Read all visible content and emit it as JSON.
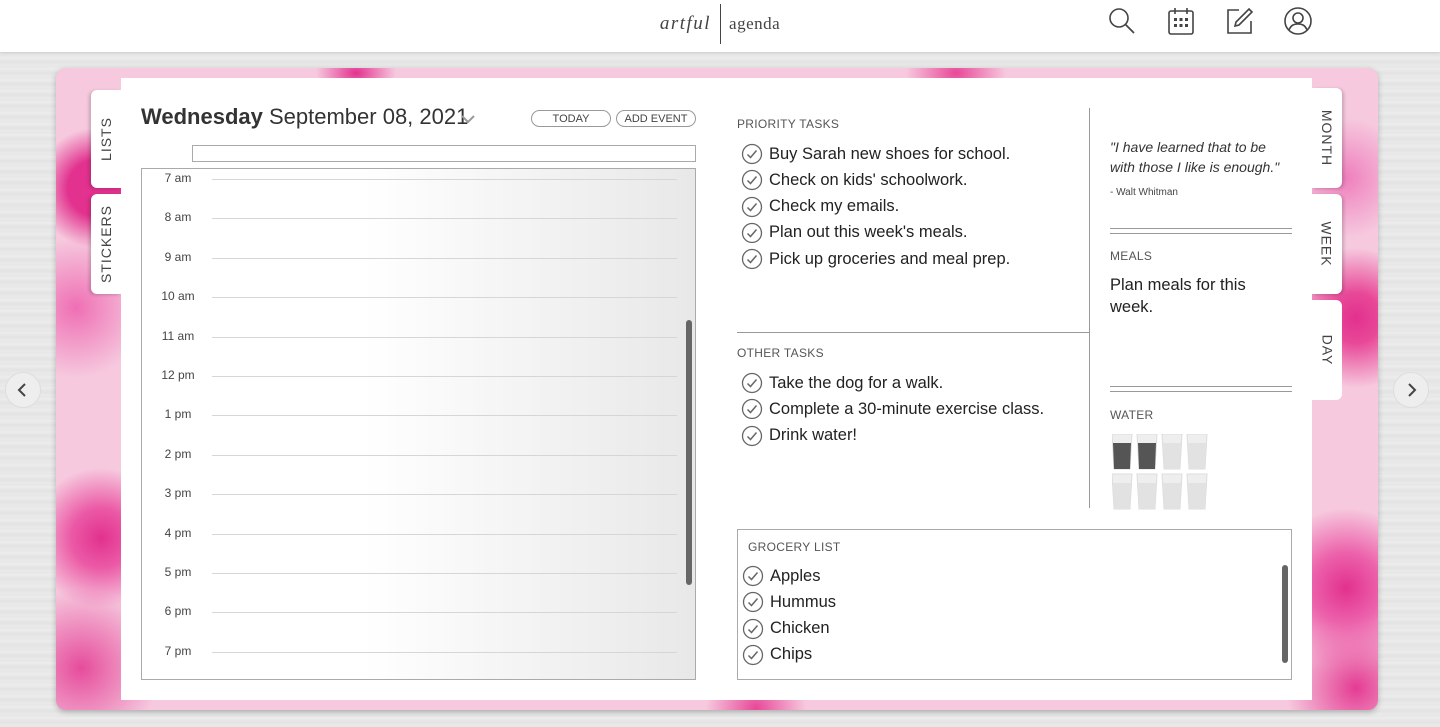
{
  "app": {
    "logo_part1": "artful",
    "logo_part2": "agenda"
  },
  "header_icons": [
    "search-icon",
    "calendar-icon",
    "edit-icon",
    "user-icon"
  ],
  "left_tabs": [
    "LISTS",
    "STICKERS"
  ],
  "right_tabs": [
    "MONTH",
    "WEEK",
    "DAY"
  ],
  "day": {
    "weekday": "Wednesday",
    "date": "September 08, 2021",
    "today_label": "TODAY",
    "add_event_label": "ADD EVENT",
    "hours": [
      "7 am",
      "8 am",
      "9 am",
      "10 am",
      "11 am",
      "12 pm",
      "1 pm",
      "2 pm",
      "3 pm",
      "4 pm",
      "5 pm",
      "6 pm",
      "7 pm"
    ]
  },
  "priority": {
    "label": "PRIORITY TASKS",
    "items": [
      "Buy Sarah new shoes for school.",
      "Check on kids' schoolwork.",
      "Check my emails.",
      "Plan out this week's meals.",
      "Pick up groceries and meal prep."
    ]
  },
  "other": {
    "label": "OTHER TASKS",
    "items": [
      "Take the dog for a walk.",
      "Complete a 30-minute exercise class.",
      "Drink water!"
    ]
  },
  "quote": {
    "text": "\"I have learned that to be with those I like is enough.\"",
    "author": "- Walt Whitman"
  },
  "meals": {
    "label": "MEALS",
    "text": "Plan meals for this week."
  },
  "water": {
    "label": "WATER",
    "filled": 2,
    "total": 8
  },
  "grocery": {
    "label": "GROCERY LIST",
    "items": [
      "Apples",
      "Hummus",
      "Chicken",
      "Chips"
    ]
  },
  "colors": {
    "accent_pink": "#e2318e",
    "page": "#ffffff",
    "water_filled": "#555555",
    "water_empty": "#e2e2e2"
  }
}
